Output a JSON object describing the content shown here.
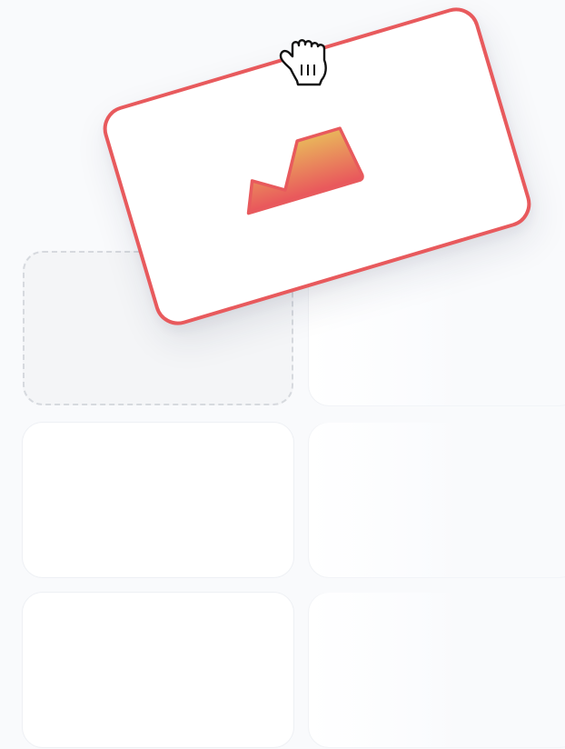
{
  "canvas": {
    "background": "#f9fafc"
  },
  "tiles": [
    {
      "id": "tile-r1-c1",
      "state": "drop-placeholder"
    },
    {
      "id": "tile-r1-c2",
      "state": "empty"
    },
    {
      "id": "tile-r2-c1",
      "state": "empty"
    },
    {
      "id": "tile-r2-c2",
      "state": "empty"
    },
    {
      "id": "tile-r3-c1",
      "state": "empty"
    },
    {
      "id": "tile-r3-c2",
      "state": "empty"
    }
  ],
  "dragged_card": {
    "icon": "area-chart-icon",
    "border_color": "#e85a5d",
    "gradient_top": "#e9b55b",
    "gradient_bottom": "#e9555c",
    "state": "being-dragged"
  },
  "cursor": {
    "icon": "grab-hand-cursor-icon"
  }
}
